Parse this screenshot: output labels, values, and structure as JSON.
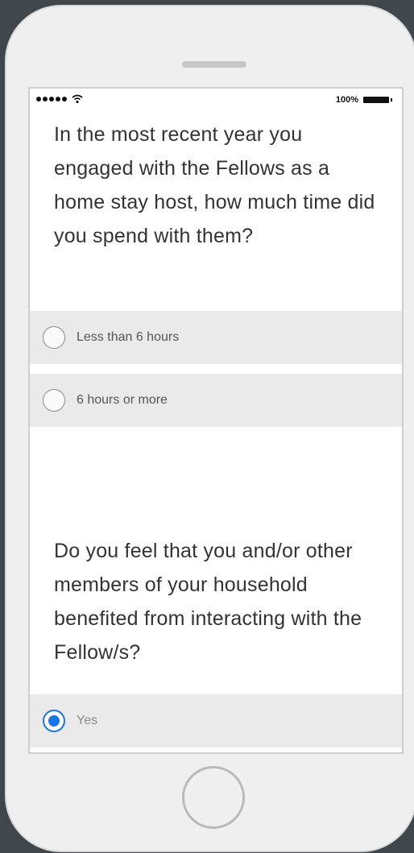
{
  "status": {
    "battery_percent": "100%"
  },
  "questions": [
    {
      "text": "In the most recent year you engaged with the Fellows as a home stay host, how much time did you spend with them?",
      "options": [
        {
          "label": "Less than 6 hours",
          "selected": false
        },
        {
          "label": "6 hours or more",
          "selected": false
        }
      ]
    },
    {
      "text": "Do you feel that you and/or other members of your household benefited from interacting with the Fellow/s?",
      "options": [
        {
          "label": "Yes",
          "selected": true
        }
      ]
    }
  ],
  "colors": {
    "accent": "#1a73e8",
    "option_bg": "#eaeaea",
    "text": "#333333"
  }
}
